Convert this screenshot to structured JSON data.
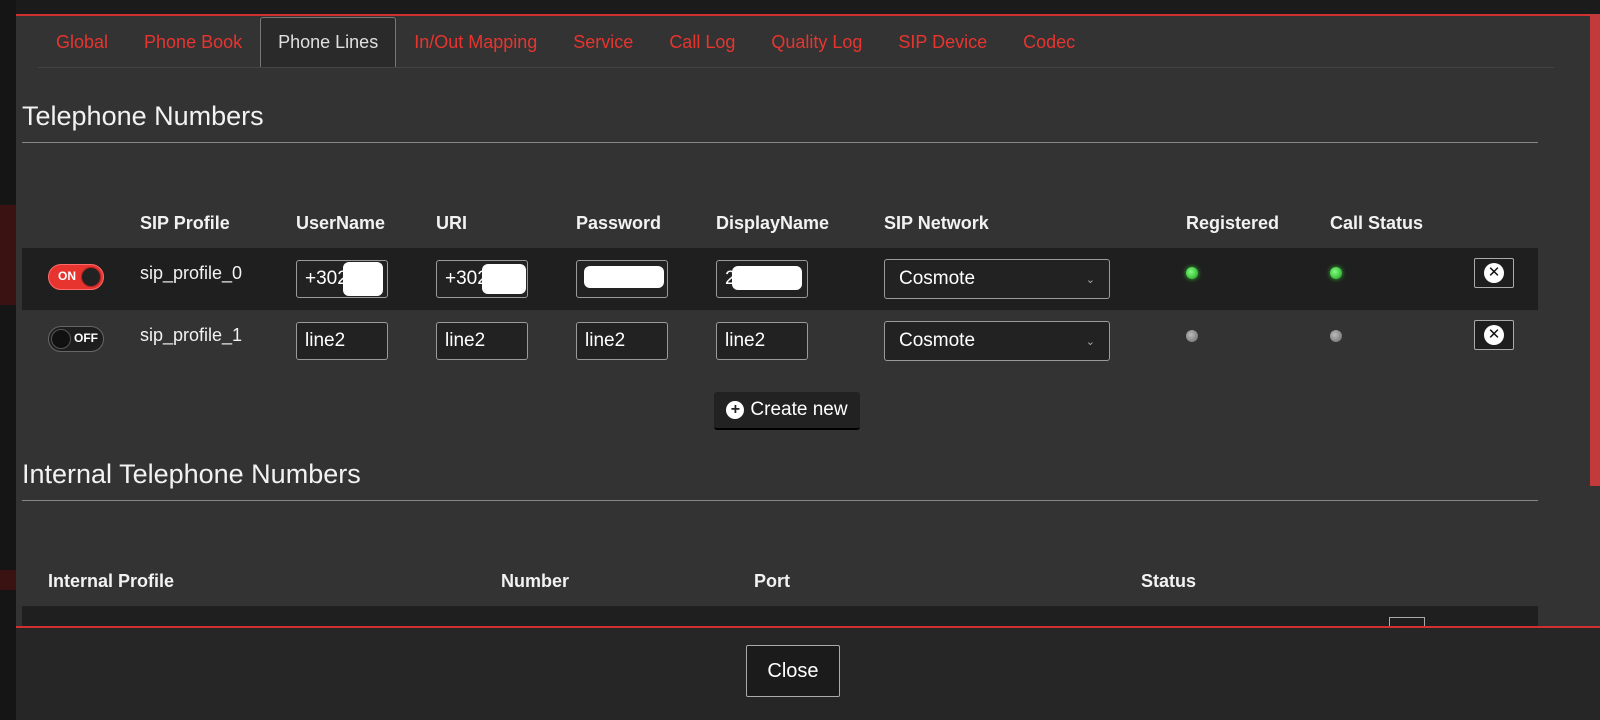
{
  "tabs": [
    {
      "label": "Global",
      "active": false
    },
    {
      "label": "Phone Book",
      "active": false
    },
    {
      "label": "Phone Lines",
      "active": true
    },
    {
      "label": "In/Out Mapping",
      "active": false
    },
    {
      "label": "Service",
      "active": false
    },
    {
      "label": "Call Log",
      "active": false
    },
    {
      "label": "Quality Log",
      "active": false
    },
    {
      "label": "SIP Device",
      "active": false
    },
    {
      "label": "Codec",
      "active": false
    }
  ],
  "telephone_numbers": {
    "title": "Telephone Numbers",
    "headers": {
      "sip_profile": "SIP Profile",
      "username": "UserName",
      "uri": "URI",
      "password": "Password",
      "display_name": "DisplayName",
      "sip_network": "SIP Network",
      "registered": "Registered",
      "call_status": "Call Status"
    },
    "rows": [
      {
        "toggle": "ON",
        "profile": "sip_profile_0",
        "username": "+3021",
        "uri": "+3021",
        "password": "",
        "display_name": "2",
        "sip_network": "Cosmote",
        "registered": "green",
        "call_status": "green"
      },
      {
        "toggle": "OFF",
        "profile": "sip_profile_1",
        "username": "line2",
        "uri": "line2",
        "password": "line2",
        "display_name": "line2",
        "sip_network": "Cosmote",
        "registered": "grey",
        "call_status": "grey"
      }
    ],
    "create_new_label": "Create new"
  },
  "internal_numbers": {
    "title": "Internal Telephone Numbers",
    "headers": {
      "internal_profile": "Internal Profile",
      "number": "Number",
      "port": "Port",
      "status": "Status"
    }
  },
  "footer": {
    "close_label": "Close"
  },
  "colors": {
    "accent": "#e8342f",
    "modal_bg": "#333333",
    "row_bg": "#1f1f1f"
  }
}
